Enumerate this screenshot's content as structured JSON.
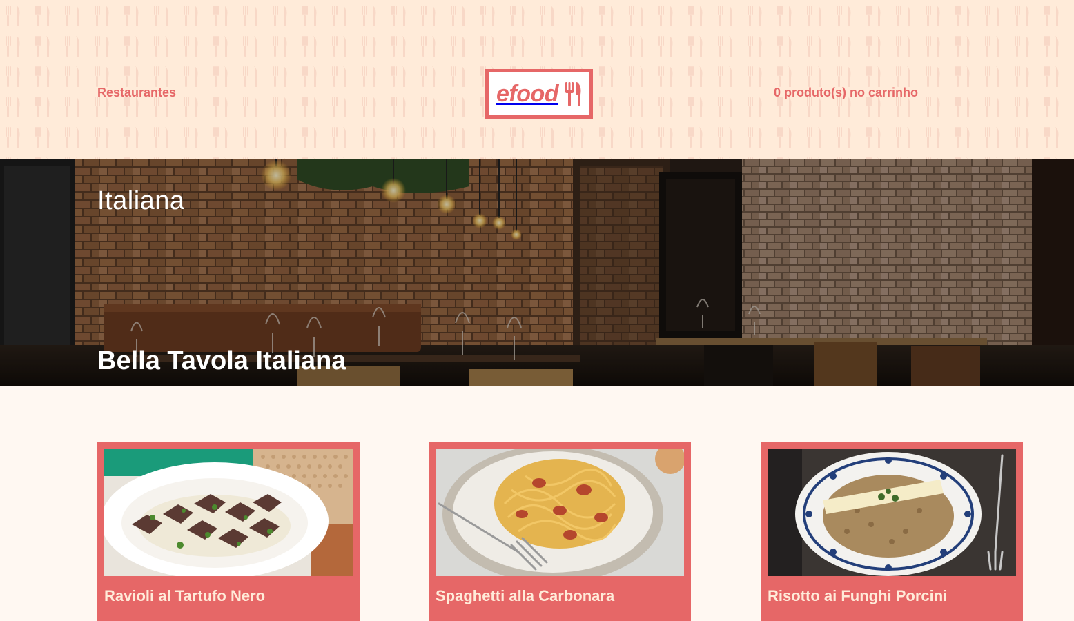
{
  "header": {
    "restaurants_link": "Restaurantes",
    "logo_text": "efood",
    "cart_text": "0 produto(s) no carrinho"
  },
  "banner": {
    "category": "Italiana",
    "restaurant_name": "Bella Tavola Italiana"
  },
  "products": [
    {
      "title": "Ravioli al Tartufo Nero"
    },
    {
      "title": "Spaghetti alla Carbonara"
    },
    {
      "title": "Risotto ai Funghi Porcini"
    }
  ],
  "colors": {
    "primary": "#E66767",
    "header_bg": "#FFEBD9",
    "page_bg": "#FFF8F2",
    "card_text": "#FFEBD9"
  },
  "icons": {
    "logo_icon": "fork-knife-icon",
    "pattern_icon": "fork-knife-icon"
  }
}
